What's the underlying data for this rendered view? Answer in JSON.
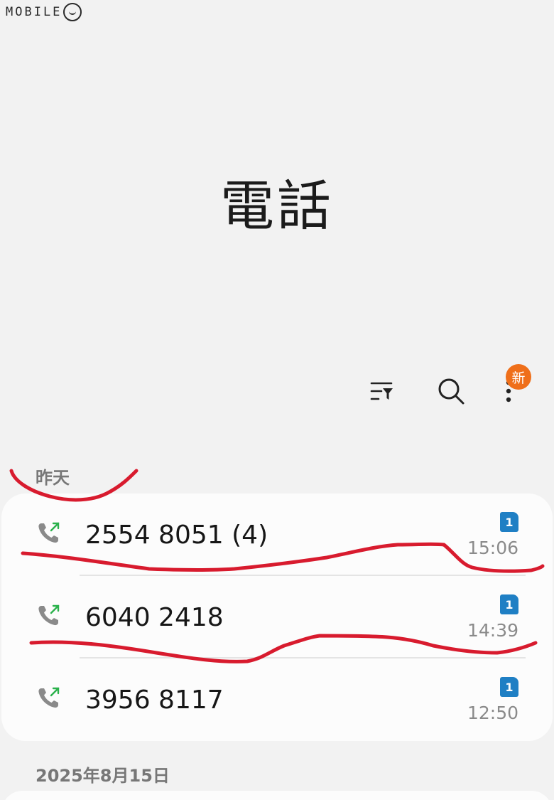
{
  "watermark": {
    "text": "MOBILE"
  },
  "header": {
    "title": "電話"
  },
  "toolbar": {
    "filter_icon": "filter-list-icon",
    "search_icon": "search-icon",
    "more_icon": "more-vertical-icon",
    "new_badge": "新"
  },
  "sections": {
    "yesterday": "昨天",
    "older": "2025年8月15日"
  },
  "calls": [
    {
      "number": "2554 8051 (4)",
      "time": "15:06",
      "sim": "1",
      "type": "outgoing"
    },
    {
      "number": "6040 2418",
      "time": "14:39",
      "sim": "1",
      "type": "outgoing"
    },
    {
      "number": "3956 8117",
      "time": "12:50",
      "sim": "1",
      "type": "outgoing"
    }
  ],
  "colors": {
    "accent_badge": "#ef6f1a",
    "sim_badge": "#1f7fc4",
    "outgoing_arrow": "#2bb24c",
    "annotation": "#d81b2e"
  }
}
